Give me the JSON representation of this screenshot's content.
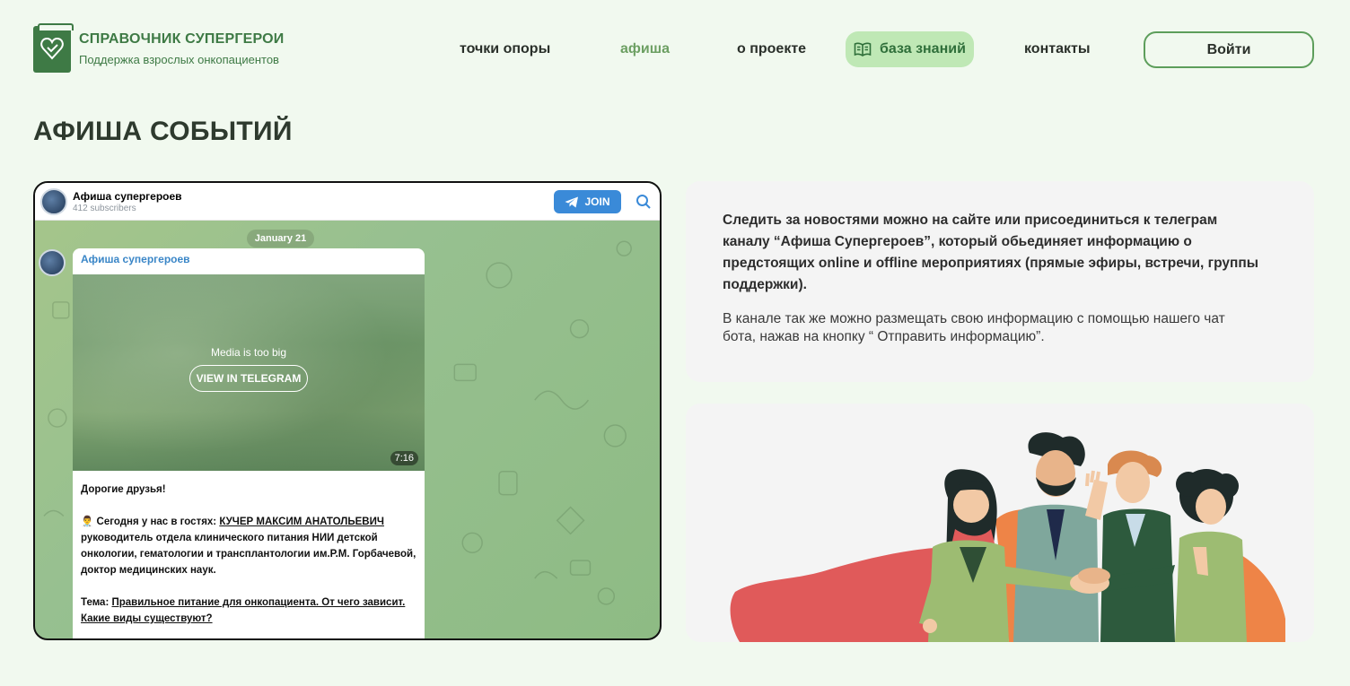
{
  "header": {
    "logo_title": "СПРАВОЧНИК СУПЕРГЕРОИ",
    "logo_subtitle": "Поддержка взрослых онкопациентов",
    "nav": [
      {
        "label": "точки опоры",
        "active": false
      },
      {
        "label": "афиша",
        "active": true
      },
      {
        "label": "о проекте",
        "active": false
      },
      {
        "label": "база знаний",
        "active": false,
        "icon": "book-icon"
      },
      {
        "label": "контакты",
        "active": false
      }
    ],
    "login_label": "Войти"
  },
  "page": {
    "title": "АФИША СОБЫТИЙ"
  },
  "telegram": {
    "channel_name": "Афиша супергероев",
    "subscribers": "412 subscribers",
    "join_label": "JOIN",
    "date_label": "January 21",
    "message_author": "Афиша супергероев",
    "media_notice": "Media is too big",
    "view_button": "VIEW IN TELEGRAM",
    "duration": "7:16",
    "greeting": "Дорогие друзья!",
    "guest_prefix": "👨‍⚕️ Сегодня у нас в гостях: ",
    "guest_name": "КУЧЕР МАКСИМ АНАТОЛЬЕВИЧ",
    "guest_desc": "руководитель отдела клинического питания НИИ детской онкологии, гематологии и трансплантологии им.Р.М. Горбачевой, доктор медицинских наук.",
    "topic_prefix": "Тема: ",
    "topic": "Правильное питание для онкопациента. От чего зависит. Какие виды существуют?"
  },
  "info": {
    "bold_text": "Следить за новостями можно на сайте или присоединиться к телеграм каналу “Афиша Супергероев”, который обьединяет информацию о предстоящих  online и offline мероприятиях (прямые эфиры, встречи, группы поддержки).",
    "regular_text": "В канале так же можно размещать свою информацию с помощью нашего чат бота, нажав на кнопку “ Отправить информацию”."
  },
  "colors": {
    "background": "#f1f9ef",
    "brand_green": "#3e7a45",
    "active_nav": "#6c9f62",
    "pill_bg": "#bfe8b5",
    "telegram_blue": "#3a8ad8",
    "card_bg": "#f4f4f4"
  }
}
